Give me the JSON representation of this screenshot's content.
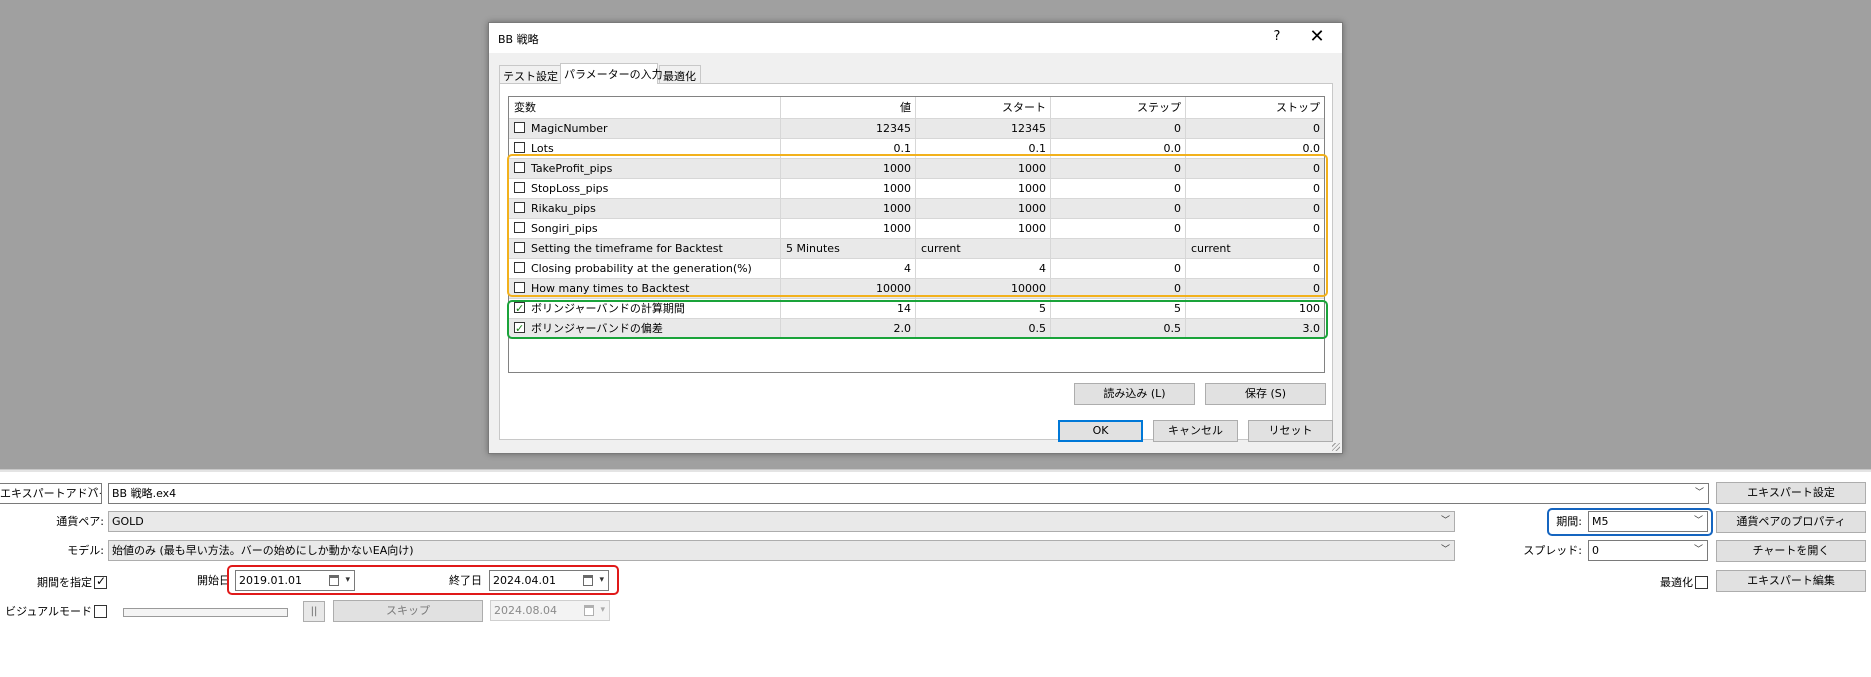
{
  "dialog": {
    "title": "BB 戦略",
    "help_glyph": "?",
    "close_glyph": "✕",
    "tabs": [
      "テスト設定",
      "パラメーターの入力",
      "最適化"
    ],
    "active_tab": 1,
    "columns": [
      "変数",
      "値",
      "スタート",
      "ステップ",
      "ストップ"
    ],
    "rows": [
      {
        "name": "MagicNumber",
        "checked": false,
        "value": "12345",
        "start": "12345",
        "step": "0",
        "stop": "0"
      },
      {
        "name": "Lots",
        "checked": false,
        "value": "0.1",
        "start": "0.1",
        "step": "0.0",
        "stop": "0.0"
      },
      {
        "name": "TakeProfit_pips",
        "checked": false,
        "value": "1000",
        "start": "1000",
        "step": "0",
        "stop": "0"
      },
      {
        "name": "StopLoss_pips",
        "checked": false,
        "value": "1000",
        "start": "1000",
        "step": "0",
        "stop": "0"
      },
      {
        "name": "Rikaku_pips",
        "checked": false,
        "value": "1000",
        "start": "1000",
        "step": "0",
        "stop": "0"
      },
      {
        "name": "Songiri_pips",
        "checked": false,
        "value": "1000",
        "start": "1000",
        "step": "0",
        "stop": "0"
      },
      {
        "name": "Setting the timeframe for Backtest",
        "checked": false,
        "value": "5 Minutes",
        "start": "current",
        "step": "",
        "stop": "current",
        "text": true
      },
      {
        "name": "Closing probability at the generation(%)",
        "checked": false,
        "value": "4",
        "start": "4",
        "step": "0",
        "stop": "0"
      },
      {
        "name": "How many times to Backtest",
        "checked": false,
        "value": "10000",
        "start": "10000",
        "step": "0",
        "stop": "0"
      },
      {
        "name": "ボリンジャーバンドの計算期間",
        "checked": true,
        "value": "14",
        "start": "5",
        "step": "5",
        "stop": "100"
      },
      {
        "name": "ボリンジャーバンドの偏差",
        "checked": true,
        "value": "2.0",
        "start": "0.5",
        "step": "0.5",
        "stop": "3.0"
      }
    ],
    "load_button": "読み込み (L)",
    "save_button": "保存 (S)",
    "ok_button": "OK",
    "cancel_button": "キャンセル",
    "reset_button": "リセット"
  },
  "tester": {
    "ea_type_label": "エキスパートアドバイザ",
    "ea_file": "BB 戦略.ex4",
    "ea_settings_button": "エキスパート設定",
    "symbol_label": "通貨ペア:",
    "symbol_value": "GOLD",
    "period_label": "期間:",
    "period_value": "M5",
    "symbol_props_button": "通貨ペアのプロパティ",
    "model_label": "モデル:",
    "model_value": "始値のみ (最も早い方法。バーの始めにしか動かないEA向け)",
    "spread_label": "スプレッド:",
    "spread_value": "0",
    "open_chart_button": "チャートを開く",
    "use_date_label": "期間を指定",
    "use_date_checked": true,
    "start_label": "開始日",
    "start_value": "2019.01.01",
    "end_label": "終了日",
    "end_value": "2024.04.01",
    "optimization_label": "最適化",
    "optimization_checked": false,
    "edit_ea_button": "エキスパート編集",
    "visual_label": "ビジュアルモード",
    "visual_checked": false,
    "pause_glyph": "||",
    "skip_button": "スキップ",
    "skip_date": "2024.08.04"
  },
  "colors": {
    "highlight_orange": "#f2b11c",
    "highlight_green": "#1aa33a",
    "highlight_red": "#e01919",
    "highlight_blue": "#1565c0"
  }
}
